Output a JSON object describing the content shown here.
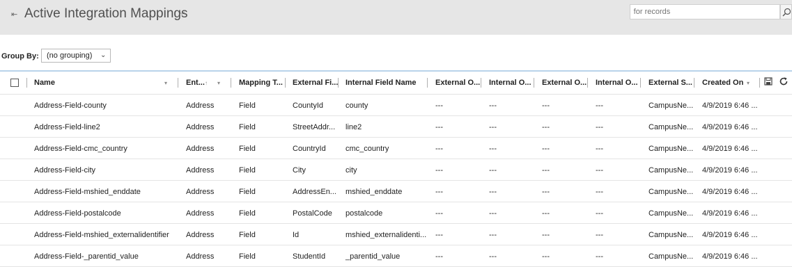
{
  "header": {
    "title": "Active Integration Mappings",
    "search_placeholder": "ch for records"
  },
  "group_by": {
    "label": "Group By:",
    "value": "(no grouping)"
  },
  "columns": [
    "Name",
    "Ent...",
    "Mapping T...",
    "External Fi...",
    "Internal Field Name",
    "External O...",
    "Internal O...",
    "External O...",
    "Internal O...",
    "External S...",
    "Created On"
  ],
  "rows": [
    [
      "Address-Field-county",
      "Address",
      "Field",
      "CountyId",
      "county",
      "---",
      "---",
      "---",
      "---",
      "CampusNe...",
      "4/9/2019 6:46 ..."
    ],
    [
      "Address-Field-line2",
      "Address",
      "Field",
      "StreetAddr...",
      "line2",
      "---",
      "---",
      "---",
      "---",
      "CampusNe...",
      "4/9/2019 6:46 ..."
    ],
    [
      "Address-Field-cmc_country",
      "Address",
      "Field",
      "CountryId",
      "cmc_country",
      "---",
      "---",
      "---",
      "---",
      "CampusNe...",
      "4/9/2019 6:46 ..."
    ],
    [
      "Address-Field-city",
      "Address",
      "Field",
      "City",
      "city",
      "---",
      "---",
      "---",
      "---",
      "CampusNe...",
      "4/9/2019 6:46 ..."
    ],
    [
      "Address-Field-mshied_enddate",
      "Address",
      "Field",
      "AddressEn...",
      "mshied_enddate",
      "---",
      "---",
      "---",
      "---",
      "CampusNe...",
      "4/9/2019 6:46 ..."
    ],
    [
      "Address-Field-postalcode",
      "Address",
      "Field",
      "PostalCode",
      "postalcode",
      "---",
      "---",
      "---",
      "---",
      "CampusNe...",
      "4/9/2019 6:46 ..."
    ],
    [
      "Address-Field-mshied_externalidentifier",
      "Address",
      "Field",
      "Id",
      "mshied_externalidenti...",
      "---",
      "---",
      "---",
      "---",
      "CampusNe...",
      "4/9/2019 6:46 ..."
    ],
    [
      "Address-Field-_parentid_value",
      "Address",
      "Field",
      "StudentId",
      "_parentid_value",
      "---",
      "---",
      "---",
      "---",
      "CampusNe...",
      "4/9/2019 6:46 ..."
    ]
  ],
  "icons": {
    "pin": "pin-icon",
    "title_dropdown": "chevron-down-icon",
    "search": "search-icon",
    "save_view": "save-icon",
    "refresh": "refresh-icon"
  },
  "colors": {
    "header_bg": "#e6e6e6",
    "grid_top_border": "#b9d3ea"
  }
}
